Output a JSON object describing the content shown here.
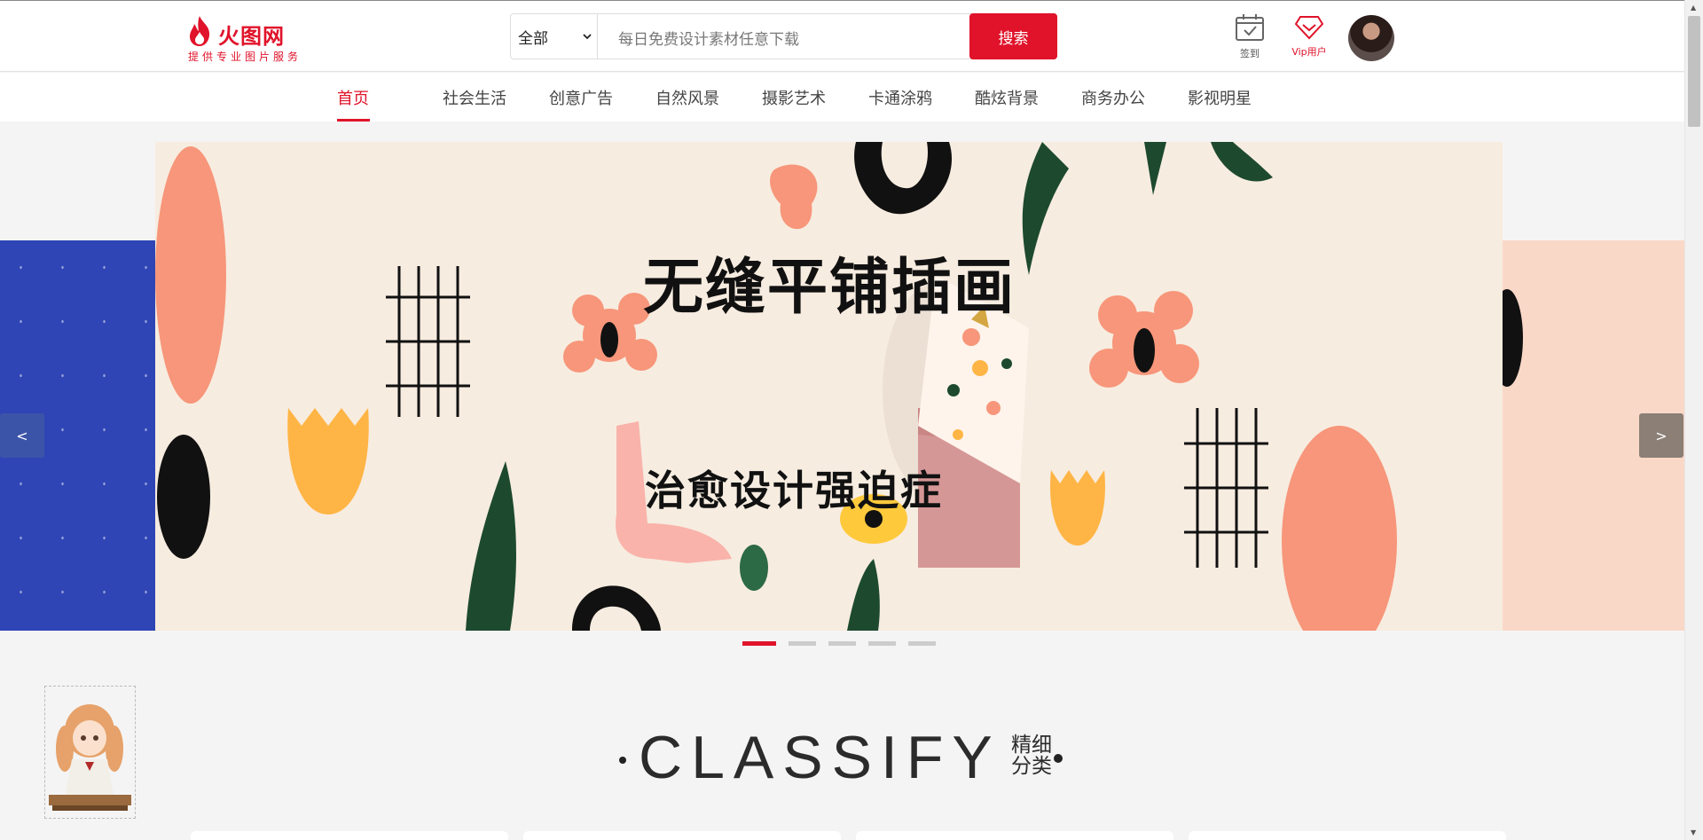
{
  "brand": {
    "name": "火图网",
    "slogan": "提供专业图片服务",
    "accent_color": "#e0132a"
  },
  "search": {
    "category_selected": "全部",
    "placeholder": "每日免费设计素材任意下载",
    "button_label": "搜索"
  },
  "header_actions": {
    "checkin_label": "签到",
    "checkin_icon": "calendar-check-icon",
    "vip_label": "Vip用户",
    "vip_icon": "diamond-icon"
  },
  "nav": {
    "items": [
      "首页",
      "社会生活",
      "创意广告",
      "自然风景",
      "摄影艺术",
      "卡通涂鸦",
      "酷炫背景",
      "商务办公",
      "影视明星"
    ],
    "active_index": 0
  },
  "banner": {
    "title": "无缝平铺插画",
    "subtitle": "治愈设计强迫症",
    "prev_label": "<",
    "next_label": ">",
    "slide_count": 5,
    "active_slide": 0
  },
  "section": {
    "title_en": "CLASSIFY",
    "title_cn_line1": "精细",
    "title_cn_line2": "分类"
  }
}
